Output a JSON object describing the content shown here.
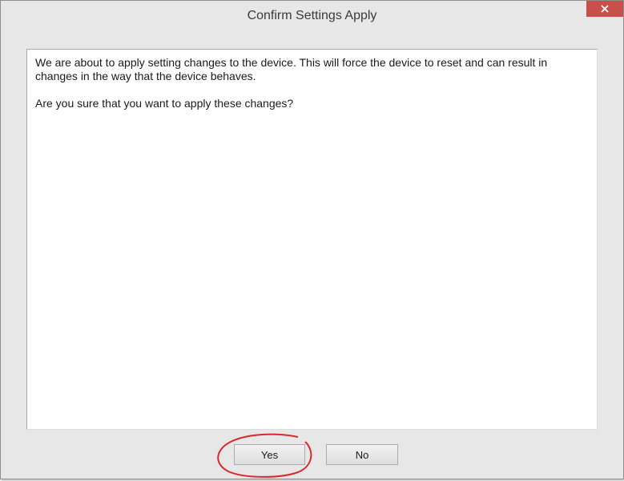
{
  "dialog": {
    "title": "Confirm Settings Apply",
    "close_glyph": "×",
    "close_icon": "close-icon",
    "message_line1": "We are about to apply setting changes to the device. This will force the device to reset and can result in changes in the way that the device behaves.",
    "message_line2": "Are you sure that you want to apply these changes?",
    "yes_label": "Yes",
    "no_label": "No"
  },
  "colors": {
    "close_button": "#c7504a",
    "window_background": "#e7e7e7",
    "content_background": "#ffffff",
    "annotation_circle": "#d9282d"
  }
}
